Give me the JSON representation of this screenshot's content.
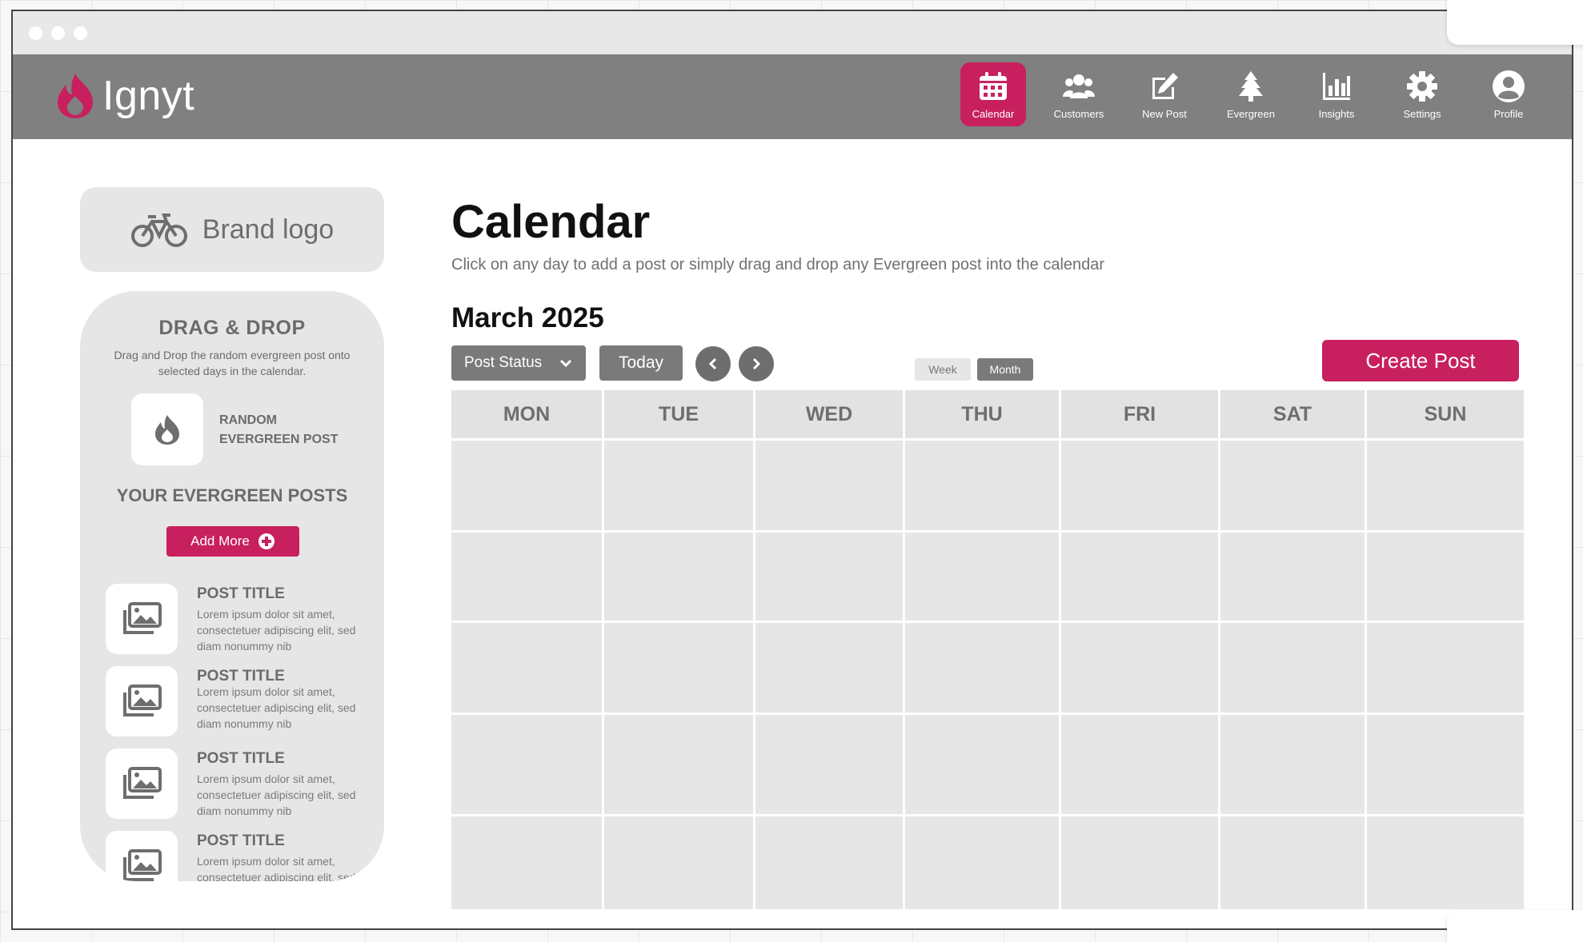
{
  "app": {
    "name": "Ignyt",
    "accent_color": "#c8205e",
    "nav_color": "#808080"
  },
  "nav": {
    "items": [
      {
        "label": "Calendar",
        "icon": "calendar-icon",
        "active": true
      },
      {
        "label": "Customers",
        "icon": "users-icon",
        "active": false
      },
      {
        "label": "New Post",
        "icon": "edit-icon",
        "active": false
      },
      {
        "label": "Evergreen",
        "icon": "tree-icon",
        "active": false
      },
      {
        "label": "Insights",
        "icon": "bar-chart-icon",
        "active": false
      },
      {
        "label": "Settings",
        "icon": "gear-icon",
        "active": false
      },
      {
        "label": "Profile",
        "icon": "user-circle-icon",
        "active": false
      }
    ]
  },
  "sidebar": {
    "brand_logo": "Brand logo",
    "dnd_title": "DRAG & DROP",
    "dnd_description": "Drag and Drop the random evergreen post onto selected days in the calendar.",
    "random_post_label": "RANDOM EVERGREEN POST",
    "evergreen_title": "YOUR EVERGREEN POSTS",
    "add_more_label": "Add More",
    "posts": [
      {
        "title": "POST TITLE",
        "body": "Lorem ipsum dolor sit amet, consectetuer adipiscing elit, sed diam nonummy nib"
      },
      {
        "title": "POST TITLE",
        "body": "Lorem ipsum dolor sit amet, consectetuer adipiscing elit, sed diam nonummy nib"
      },
      {
        "title": "POST TITLE",
        "body": "Lorem ipsum dolor sit amet, consectetuer adipiscing elit, sed diam nonummy nib"
      },
      {
        "title": "POST TITLE",
        "body": "Lorem ipsum dolor sit amet, consectetuer adipiscing elit, sed diam nonummy nib"
      }
    ]
  },
  "main": {
    "title": "Calendar",
    "subtitle": "Click on any day to add a post or simply drag and drop any Evergreen post into the calendar",
    "month": "March 2025",
    "post_status_label": "Post Status",
    "today_label": "Today",
    "view_week": "Week",
    "view_month": "Month",
    "create_post_label": "Create Post",
    "weekdays": [
      "MON",
      "TUE",
      "WED",
      "THU",
      "FRI",
      "SAT",
      "SUN"
    ]
  }
}
